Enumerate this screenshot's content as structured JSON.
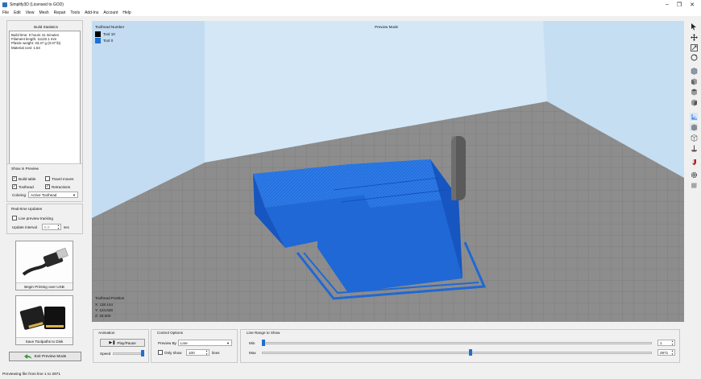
{
  "window": {
    "title": "Simplify3D (Licensed to GOD)",
    "minimize": "–",
    "maximize": "❐",
    "close": "✕"
  },
  "menu": [
    "File",
    "Edit",
    "View",
    "Mesh",
    "Repair",
    "Tools",
    "Add-Ins",
    "Account",
    "Help"
  ],
  "build_statistics": {
    "header": "Build Statistics",
    "lines": [
      "Build time: 0 hours 41 minutes",
      "Filament length: 11132.1 mm",
      "Plastic weight: 33.47 g (0.07 lb)",
      "Material cost: 1.54"
    ]
  },
  "show_in_preview": {
    "title": "Show in Preview",
    "build_table": {
      "label": "Build table",
      "checked": true
    },
    "travel_moves": {
      "label": "Travel moves",
      "checked": false
    },
    "toolhead": {
      "label": "Toolhead",
      "checked": true
    },
    "retractions": {
      "label": "Retractions",
      "checked": true
    },
    "coloring_label": "Coloring",
    "coloring_value": "Active Toolhead"
  },
  "realtime": {
    "title": "Real-time Updates",
    "live_tracking": {
      "label": "Live preview tracking",
      "checked": false
    },
    "interval_label": "Update interval",
    "interval_value": "5.0",
    "interval_unit": "sec"
  },
  "usb_button": {
    "caption": "Begin Printing over USB",
    "icon": "usb-cable-icon"
  },
  "save_button": {
    "caption": "Save Toolpaths to Disk",
    "icon": "sd-card-icon"
  },
  "exit_button": {
    "label": "Exit Preview Mode",
    "icon": "back-arrow-icon"
  },
  "viewport": {
    "toolhead_number_title": "Toolhead Number",
    "legend": [
      {
        "label": "Tool 10",
        "color": "#000000"
      },
      {
        "label": "Tool 0",
        "color": "#1e6fd6"
      }
    ],
    "mode": "Preview Mode",
    "position_title": "Toolhead Position",
    "x": "X: 118.144",
    "y": "Y: 124.628",
    "z": "Z: 26.000",
    "model_color": "#1f68d6",
    "bed_color": "#8d8d8d",
    "sky_color": "#cfe4f6"
  },
  "right_toolbar": [
    "pointer-icon",
    "move-icon",
    "scale-icon",
    "rotate-icon",
    "view-default-icon",
    "view-front-icon",
    "view-top-icon",
    "view-side-icon",
    "axes-icon",
    "cube-solid-icon",
    "cube-wire-icon",
    "cross-section-icon",
    "tool-color-icon",
    "settings-gear-icon",
    "layers-icon"
  ],
  "animation": {
    "title": "Animation",
    "play_label": "Play/Pause",
    "speed_label": "Speed"
  },
  "control_options": {
    "title": "Control Options",
    "preview_by_label": "Preview By",
    "preview_by_value": "Line",
    "only_show_label": "Only show",
    "only_show_value": "100",
    "only_show_unit": "lines",
    "only_show_checked": false
  },
  "line_range": {
    "title": "Line Range to Show",
    "min_label": "Min",
    "max_label": "Max",
    "min_value": "1",
    "max_value": "2971",
    "total": 2971,
    "min": 1,
    "max": 2971
  },
  "status": "Previewing file from line 1 to 2971"
}
